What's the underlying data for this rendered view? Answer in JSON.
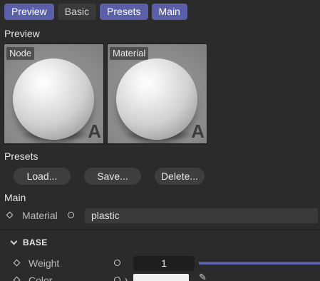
{
  "tabs": [
    {
      "label": "Preview",
      "active": true
    },
    {
      "label": "Basic",
      "active": false
    },
    {
      "label": "Presets",
      "active": true
    },
    {
      "label": "Main",
      "active": true
    }
  ],
  "preview": {
    "heading": "Preview",
    "thumbs": [
      {
        "tag": "Node",
        "letter": "A"
      },
      {
        "tag": "Material",
        "letter": "A"
      }
    ]
  },
  "presets": {
    "heading": "Presets",
    "buttons": {
      "load": "Load...",
      "save": "Save...",
      "delete": "Delete..."
    }
  },
  "main": {
    "heading": "Main",
    "material_label": "Material",
    "material_value": "plastic"
  },
  "base": {
    "group_label": "BASE",
    "weight_label": "Weight",
    "weight_value": "1",
    "weight_fraction": 1.0,
    "color_label": "Color",
    "color_value_hex": "#f0f0f0"
  },
  "colors": {
    "accent": "#5a5fa8",
    "background": "#2b2b2b"
  }
}
